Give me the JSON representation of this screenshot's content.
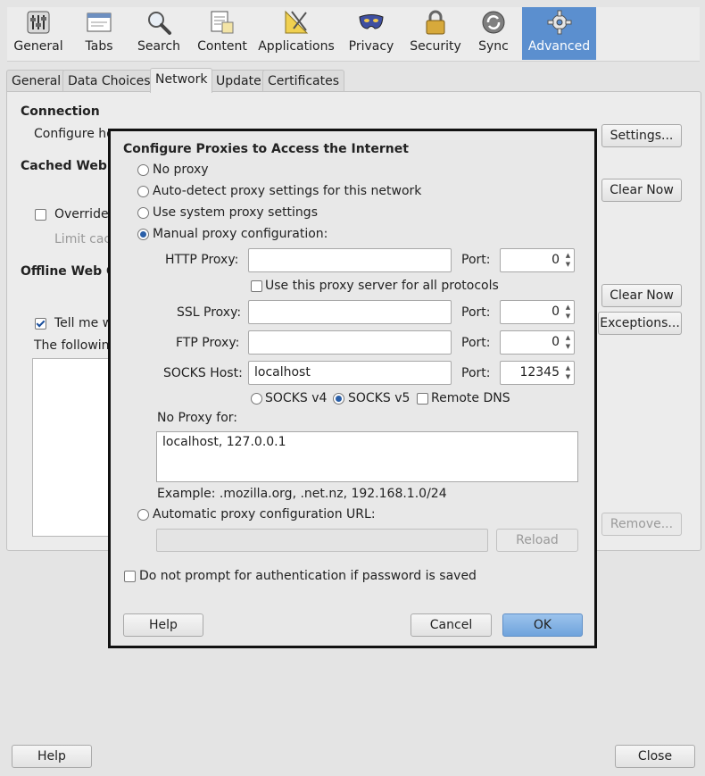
{
  "toolbar": {
    "items": [
      {
        "label": "General",
        "icon": "general-switches-icon"
      },
      {
        "label": "Tabs",
        "icon": "tabs-window-icon"
      },
      {
        "label": "Search",
        "icon": "magnifier-icon"
      },
      {
        "label": "Content",
        "icon": "content-document-icon"
      },
      {
        "label": "Applications",
        "icon": "applications-tools-icon"
      },
      {
        "label": "Privacy",
        "icon": "privacy-mask-icon"
      },
      {
        "label": "Security",
        "icon": "padlock-icon"
      },
      {
        "label": "Sync",
        "icon": "sync-arrows-icon"
      },
      {
        "label": "Advanced",
        "icon": "gear-icon"
      }
    ],
    "active": "Advanced",
    "active_color": "#5b8fcf"
  },
  "tabs": [
    "General",
    "Data Choices",
    "Network",
    "Update",
    "Certificates"
  ],
  "active_tab": "Network",
  "background": {
    "connection_heading": "Connection",
    "configure_text": "Configure ho",
    "settings_button": "Settings...",
    "cached_heading": "Cached Web C",
    "clear_now_1": "Clear Now",
    "override_label": "Override",
    "limit_label": "Limit cac",
    "offline_heading": "Offline Web C",
    "clear_now_2": "Clear Now",
    "tell_me_label": "Tell me w",
    "exceptions_button": "Exceptions...",
    "following_text": "The followin",
    "remove_button": "Remove...",
    "help_button": "Help",
    "close_button": "Close"
  },
  "dialog": {
    "title": "Configure Proxies to Access the Internet",
    "no_proxy": "No proxy",
    "auto_detect": "Auto-detect proxy settings for this network",
    "system_proxy": "Use system proxy settings",
    "manual": "Manual proxy configuration:",
    "http_label": "HTTP Proxy:",
    "http_value": "",
    "port_label": "Port:",
    "http_port": "0",
    "use_all_label": "Use this proxy server for all protocols",
    "ssl_label": "SSL Proxy:",
    "ssl_value": "",
    "ssl_port": "0",
    "ftp_label": "FTP Proxy:",
    "ftp_value": "",
    "ftp_port": "0",
    "socks_label": "SOCKS Host:",
    "socks_value": "localhost",
    "socks_port": "12345",
    "socks_v4": "SOCKS v4",
    "socks_v5": "SOCKS v5",
    "remote_dns": "Remote DNS",
    "no_proxy_for_label": "No Proxy for:",
    "no_proxy_for_value": "localhost, 127.0.0.1",
    "example_text": "Example: .mozilla.org, .net.nz, 192.168.1.0/24",
    "auto_url_label": "Automatic proxy configuration URL:",
    "auto_url_value": "",
    "reload_button": "Reload",
    "no_prompt_label": "Do not prompt for authentication if password is saved",
    "help_button": "Help",
    "cancel_button": "Cancel",
    "ok_button": "OK"
  }
}
